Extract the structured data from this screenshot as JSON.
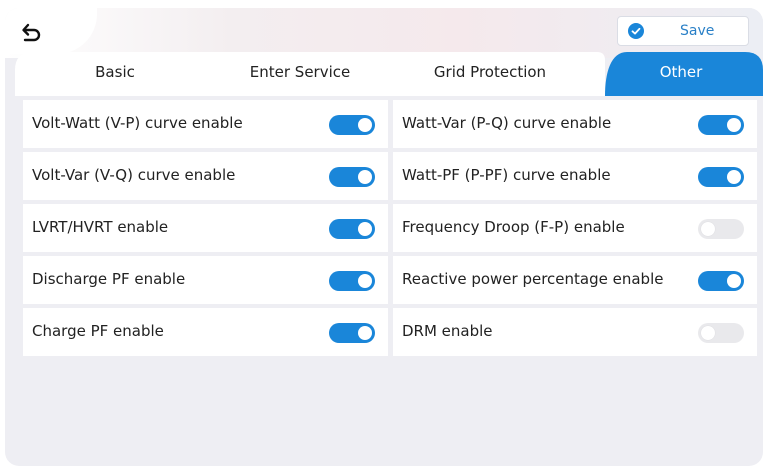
{
  "header": {
    "back_icon": "back-arrow-icon",
    "save_label": "Save",
    "save_icon": "check-circle-icon",
    "accent_color": "#1a86d9"
  },
  "tabs": [
    {
      "label": "Basic",
      "active": false
    },
    {
      "label": "Enter Service",
      "active": false
    },
    {
      "label": "Grid Protection",
      "active": false
    },
    {
      "label": "Other",
      "active": true
    }
  ],
  "settings": {
    "left": [
      {
        "label": "Volt-Watt (V-P) curve enable",
        "enabled": true
      },
      {
        "label": "Volt-Var (V-Q) curve enable",
        "enabled": true
      },
      {
        "label": "LVRT/HVRT enable",
        "enabled": true
      },
      {
        "label": "Discharge PF enable",
        "enabled": true
      },
      {
        "label": "Charge PF enable",
        "enabled": true
      }
    ],
    "right": [
      {
        "label": "Watt-Var (P-Q) curve enable",
        "enabled": true
      },
      {
        "label": "Watt-PF (P-PF) curve enable",
        "enabled": true
      },
      {
        "label": "Frequency Droop (F-P) enable",
        "enabled": false
      },
      {
        "label": "Reactive power percentage enable",
        "enabled": true
      },
      {
        "label": "DRM enable",
        "enabled": false
      }
    ]
  }
}
